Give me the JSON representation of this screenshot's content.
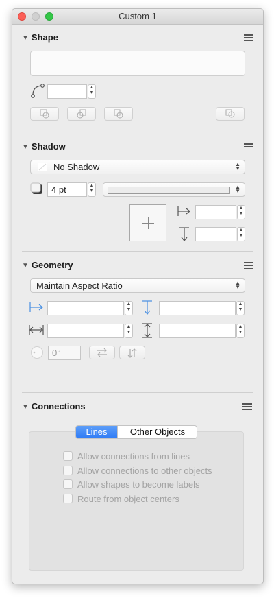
{
  "window": {
    "title": "Custom 1"
  },
  "shape": {
    "heading": "Shape"
  },
  "shadow": {
    "heading": "Shadow",
    "style_value": "No Shadow",
    "size_value": "4 pt"
  },
  "geometry": {
    "heading": "Geometry",
    "aspect_value": "Maintain Aspect Ratio",
    "rotation_value": "0°"
  },
  "connections": {
    "heading": "Connections",
    "tabs": [
      "Lines",
      "Other Objects"
    ],
    "options": [
      "Allow connections from lines",
      "Allow connections to other objects",
      "Allow shapes to become labels",
      "Route from object centers"
    ]
  },
  "colors": {
    "accent": "#2f7cf6",
    "close": "#fc5f57",
    "zoom": "#35c748"
  }
}
